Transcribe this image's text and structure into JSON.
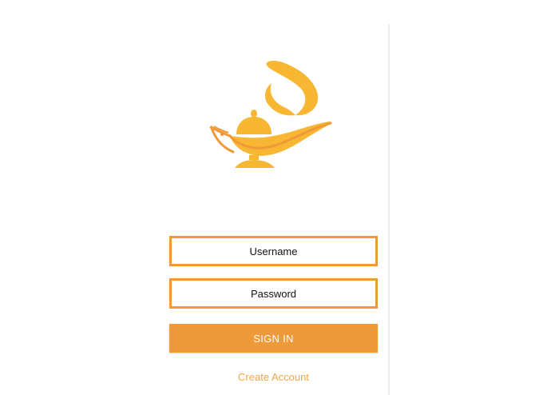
{
  "logo": {
    "icon": "magic-lamp-icon",
    "colors": {
      "primary": "#f7b733",
      "secondary": "#ee9a3a"
    }
  },
  "form": {
    "username_placeholder": "Username",
    "password_placeholder": "Password",
    "signin_label": "SIGN IN",
    "create_account_label": "Create Account"
  },
  "theme": {
    "accent": "#ee9a3a",
    "link": "#f1a64a",
    "background": "#ffffff"
  }
}
